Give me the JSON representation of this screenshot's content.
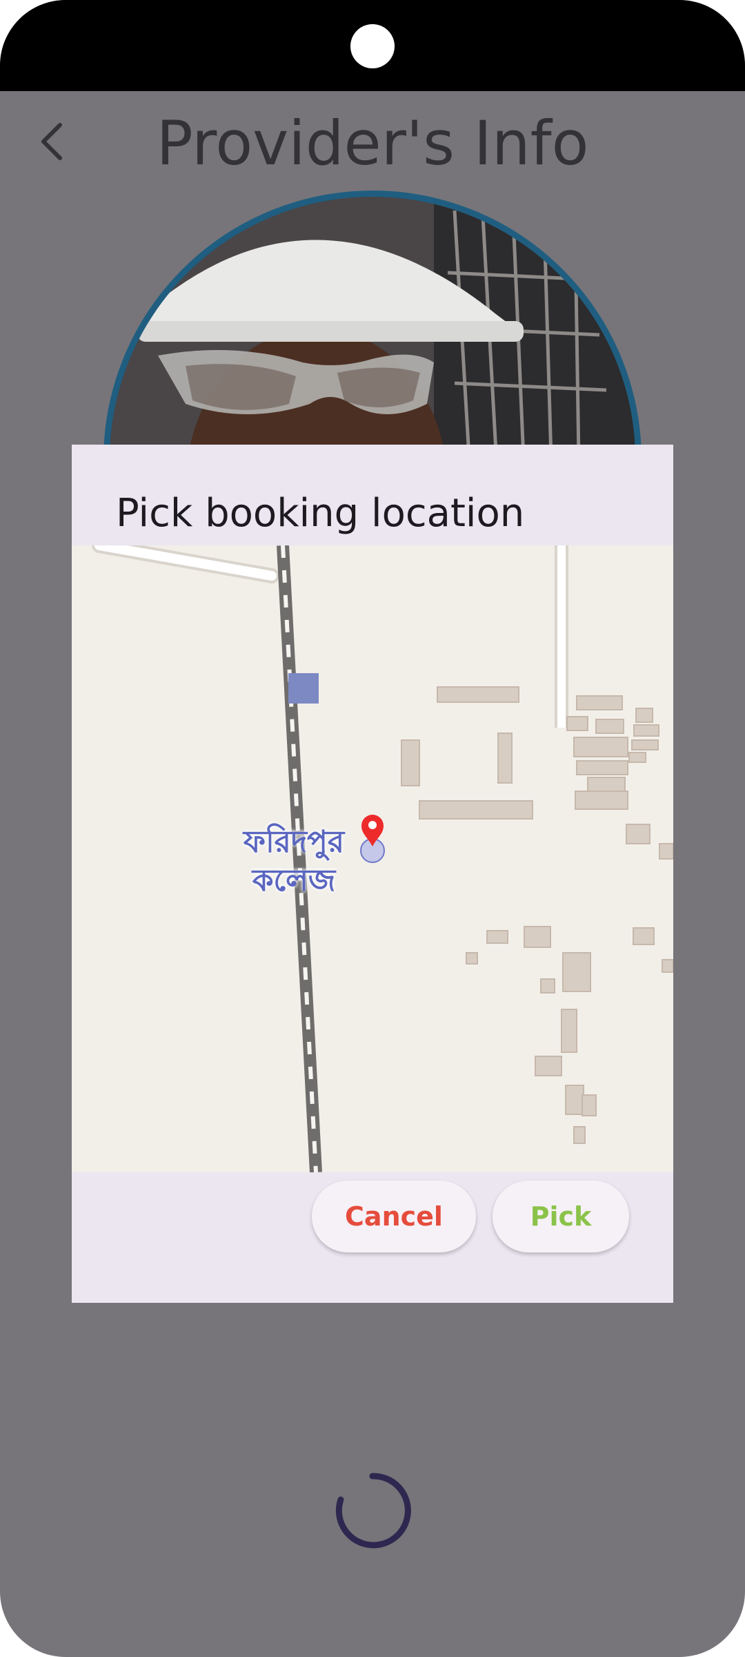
{
  "header": {
    "title": "Provider's Info",
    "back_icon": "chevron-left-icon"
  },
  "dialog": {
    "title": "Pick booking location",
    "map": {
      "place_label_line1": "ফরিদপুর",
      "place_label_line2": "কলেজ",
      "marker_icon": "location-pin-icon"
    },
    "cancel_label": "Cancel",
    "pick_label": "Pick"
  },
  "colors": {
    "scrim": "#77757a",
    "dialog_bg": "#ece6f1",
    "cancel_text": "#e54c3c",
    "pick_text": "#8bc34a",
    "avatar_ring": "#1f5e80",
    "spinner": "#2e2850"
  },
  "loading_icon": "loading-spinner-icon"
}
